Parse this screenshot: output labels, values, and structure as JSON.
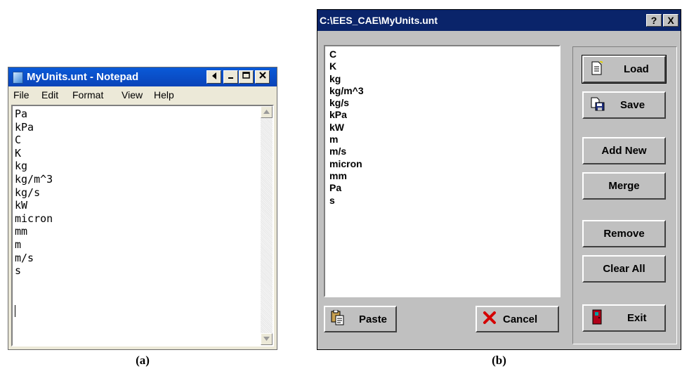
{
  "notepad": {
    "title": "MyUnits.unt - Notepad",
    "menu": [
      "File",
      "Edit",
      "Format",
      "View",
      "Help"
    ],
    "lines": [
      "Pa",
      "kPa",
      "C",
      "K",
      "kg",
      "kg/m^3",
      "kg/s",
      "kW",
      "micron",
      "mm",
      "m",
      "m/s",
      "s"
    ],
    "caption": "(a)"
  },
  "ees_dialog": {
    "title": "C:\\EES_CAE\\MyUnits.unt",
    "help_label": "?",
    "close_label": "X",
    "units": [
      "C",
      "K",
      "kg",
      "kg/m^3",
      "kg/s",
      "kPa",
      "kW",
      "m",
      "m/s",
      "micron",
      "mm",
      "Pa",
      "s"
    ],
    "buttons": {
      "load": "Load",
      "save": "Save",
      "add_new": "Add New",
      "merge": "Merge",
      "remove": "Remove",
      "clear_all": "Clear All",
      "exit": "Exit",
      "paste": "Paste",
      "cancel": "Cancel"
    },
    "icons": [
      "load-icon",
      "save-icon",
      "paste-icon",
      "cancel-x-icon",
      "exit-door-icon"
    ],
    "colors": {
      "titlebar": "#0a246a",
      "face": "#c0c0c0",
      "cancel_x": "#d40000",
      "door": "#b00018"
    },
    "caption": "(b)"
  }
}
